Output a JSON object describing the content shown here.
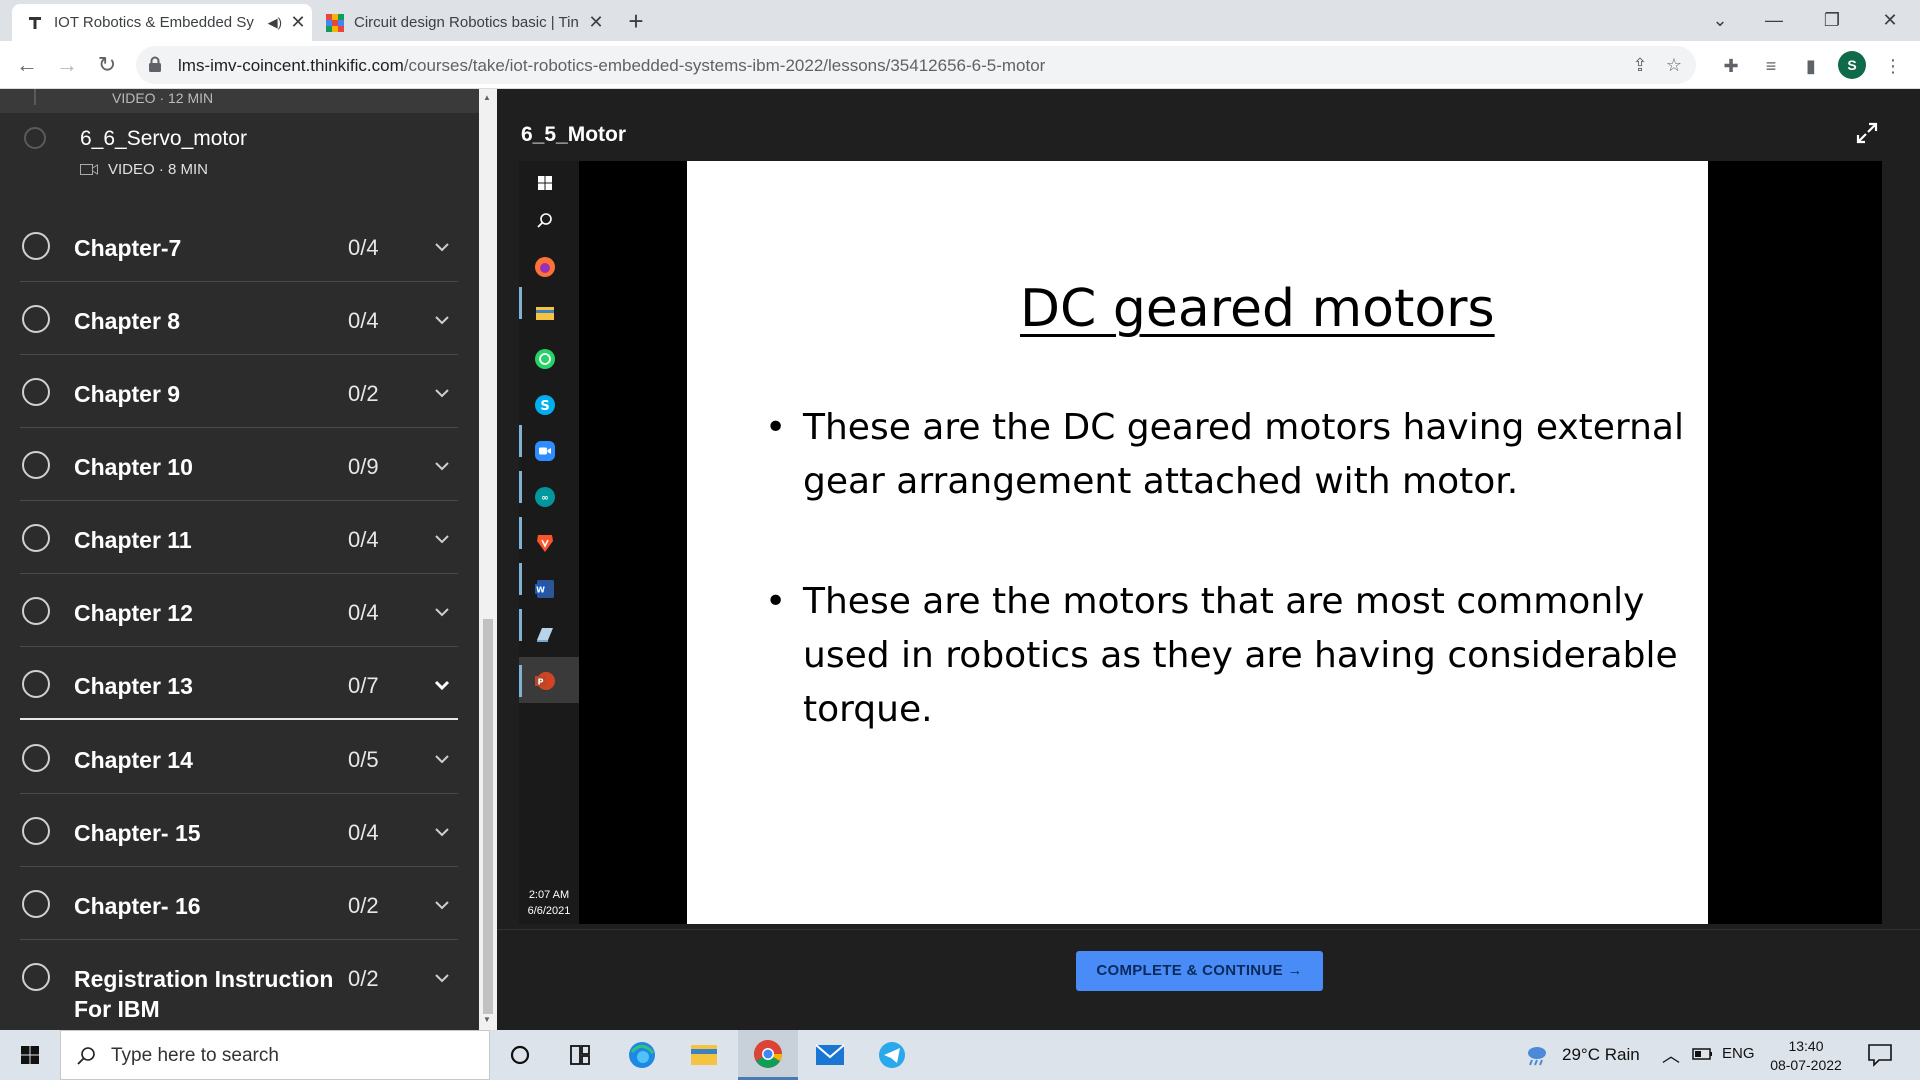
{
  "browser": {
    "tabs": [
      {
        "title": "IOT Robotics & Embedded Sy",
        "active": true
      },
      {
        "title": "Circuit design Robotics basic | Tin",
        "active": false
      }
    ],
    "url_host": "lms-imv-coincent.thinkific.com",
    "url_path": "/courses/take/iot-robotics-embedded-systems-ibm-2022/lessons/35412656-6-5-motor",
    "profile_initial": "S"
  },
  "sidebar": {
    "top_clip_text": "VIDEO · 12 MIN",
    "lesson": {
      "title": "6_6_Servo_motor",
      "meta": "VIDEO · 8 MIN"
    },
    "chapters": [
      {
        "title": "Chapter-7",
        "count": "0/4"
      },
      {
        "title": "Chapter 8",
        "count": "0/4"
      },
      {
        "title": "Chapter 9",
        "count": "0/2"
      },
      {
        "title": "Chapter 10",
        "count": "0/9"
      },
      {
        "title": "Chapter 11",
        "count": "0/4"
      },
      {
        "title": "Chapter 12",
        "count": "0/4"
      },
      {
        "title": "Chapter 13",
        "count": "0/7",
        "expanded": true
      },
      {
        "title": "Chapter 14",
        "count": "0/5"
      },
      {
        "title": "Chapter- 15",
        "count": "0/4"
      },
      {
        "title": "Chapter- 16",
        "count": "0/2"
      },
      {
        "title": "Registration Instruction For IBM",
        "count": "0/2"
      }
    ]
  },
  "main": {
    "lesson_title": "6_5_Motor",
    "video": {
      "taskbar_time": "2:07 AM",
      "taskbar_date": "6/6/2021",
      "slide_title": "DC geared motors",
      "bullets": [
        "These are the DC geared motors  having external gear arrangement attached with motor.",
        "These are the motors that are most commonly used in robotics as they are having considerable torque."
      ]
    },
    "complete_button": "COMPLETE & CONTINUE →"
  },
  "taskbar": {
    "search_placeholder": "Type here to search",
    "weather": "29°C  Rain",
    "language": "ENG",
    "time": "13:40",
    "date": "08-07-2022"
  },
  "colors": {
    "sidebar_bg": "#2c2c2c",
    "main_bg": "#1f1f1f",
    "button_bg": "#4a8cf7"
  }
}
